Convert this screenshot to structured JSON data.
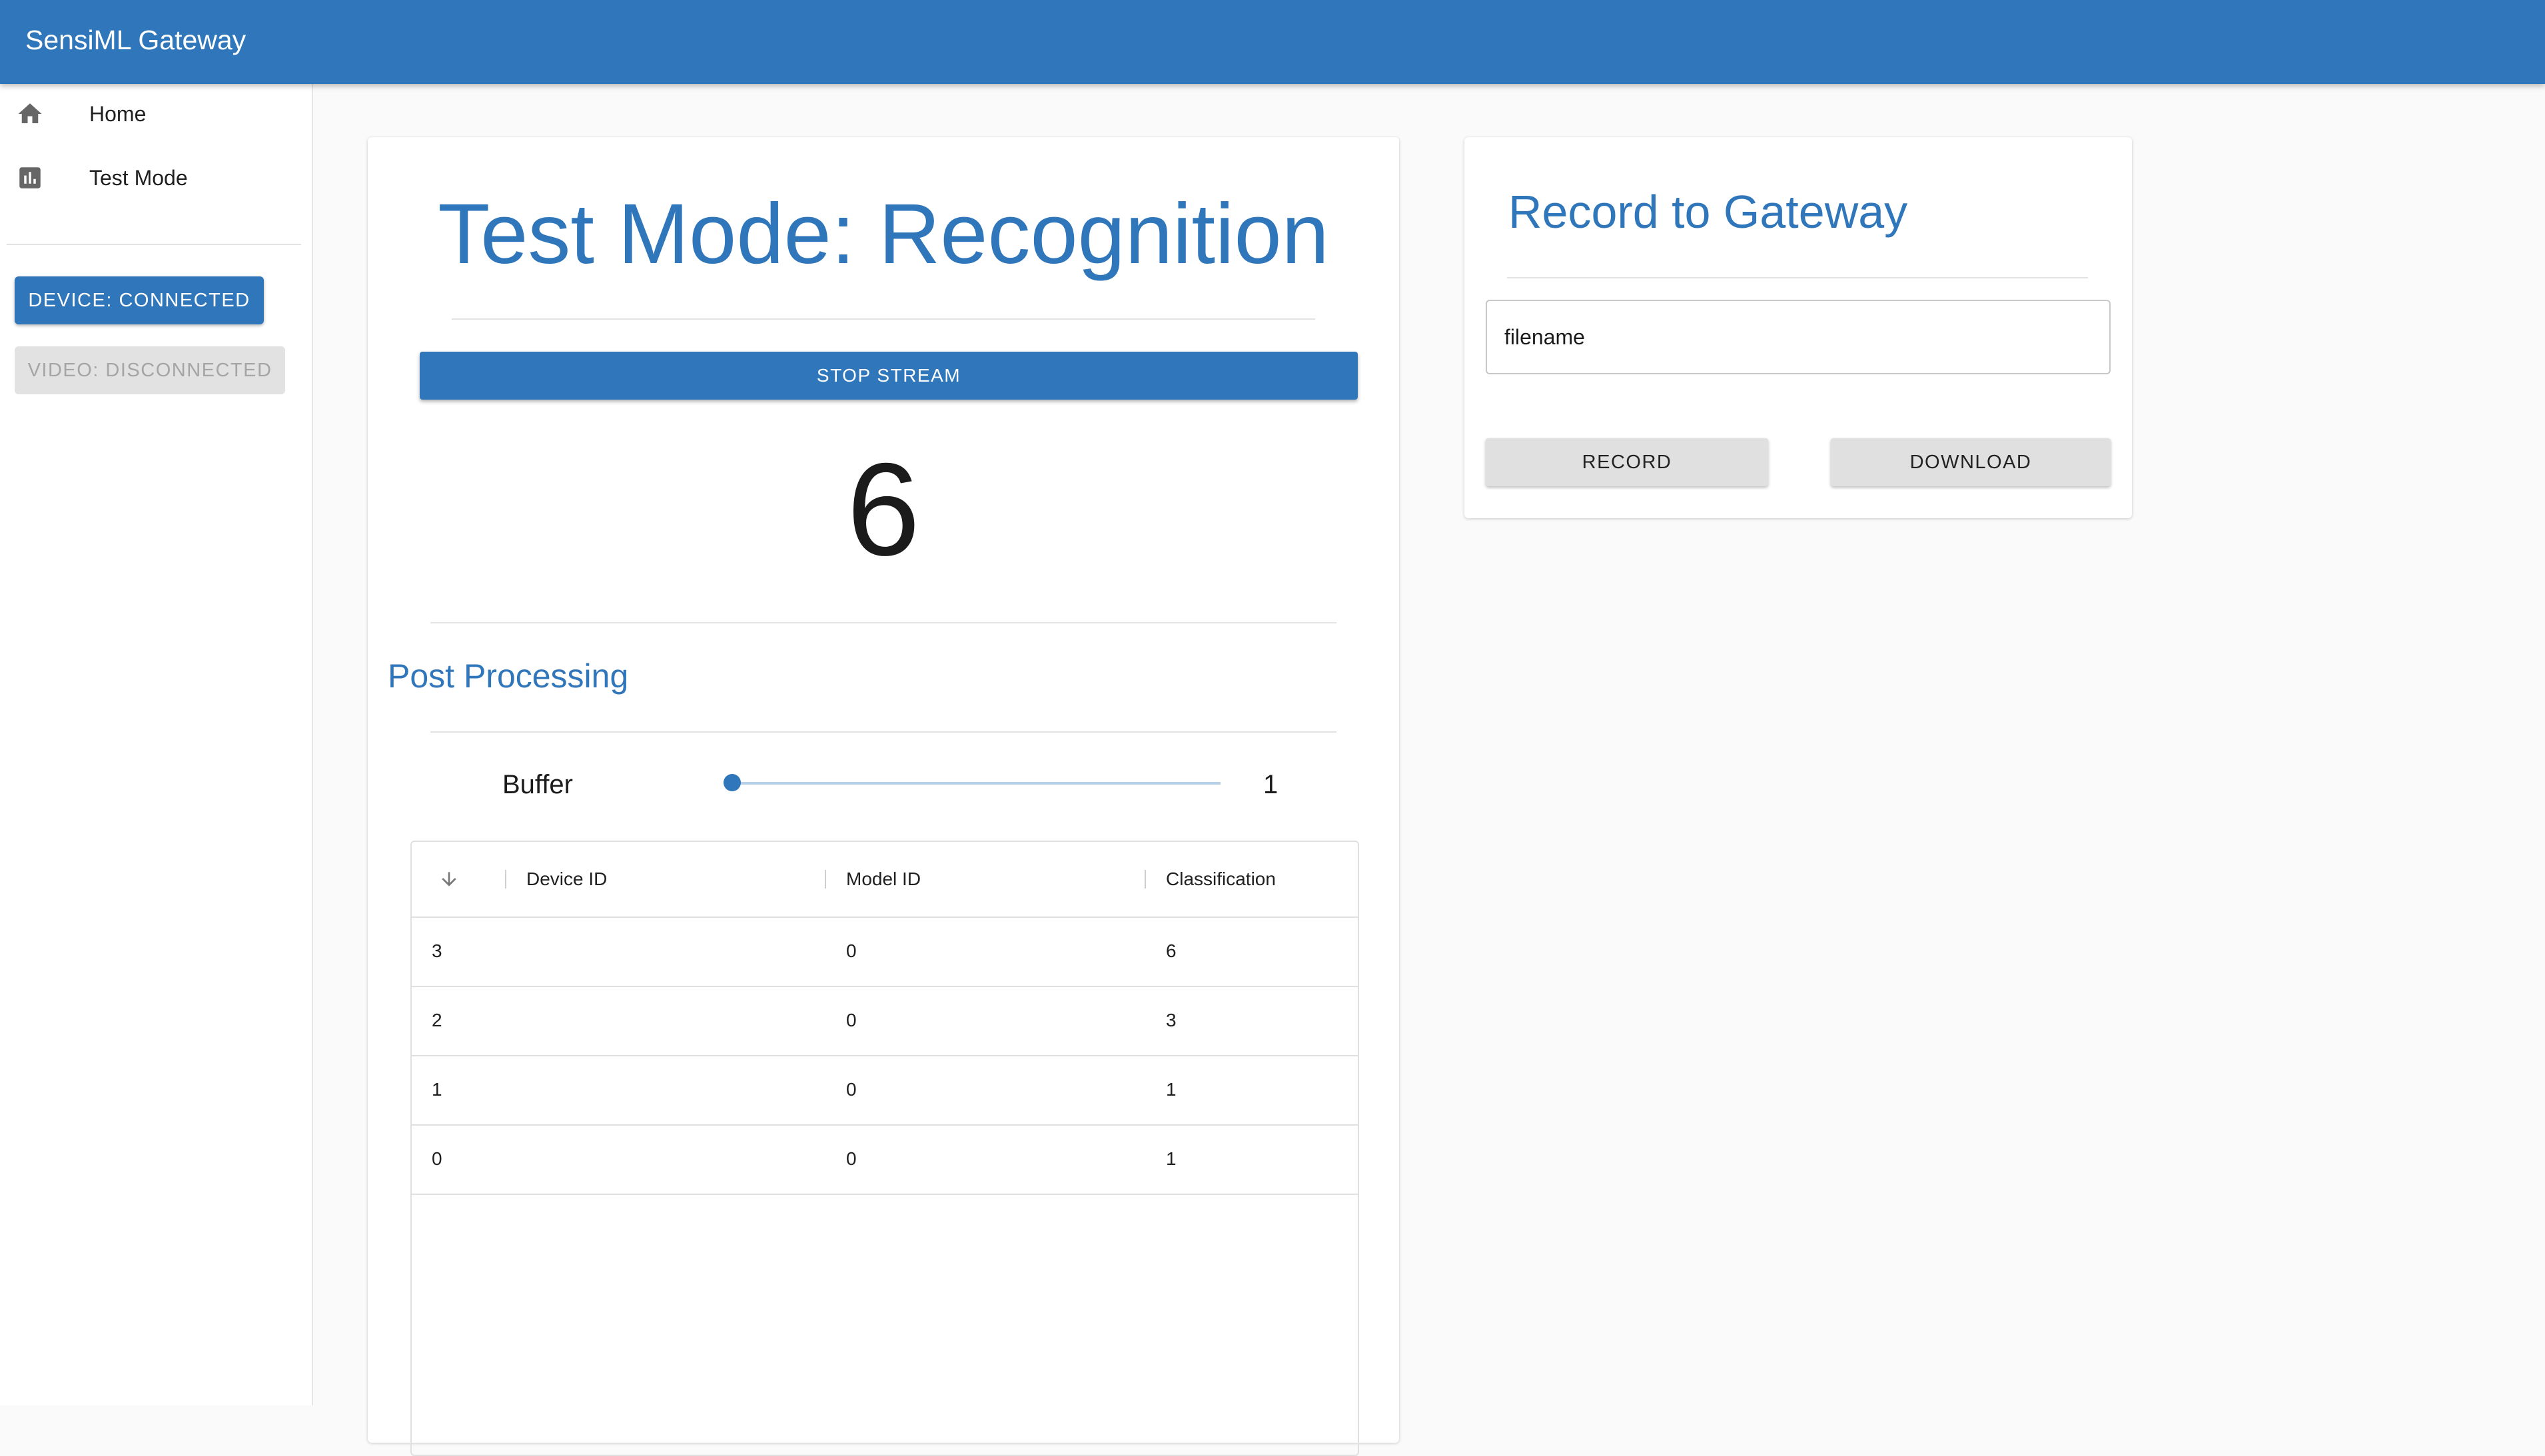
{
  "app": {
    "title": "SensiML Gateway"
  },
  "sidebar": {
    "items": [
      {
        "label": "Home",
        "icon": "home-icon"
      },
      {
        "label": "Test Mode",
        "icon": "bar-chart-icon"
      }
    ],
    "device_status": "DEVICE: CONNECTED",
    "video_status": "VIDEO: DISCONNECTED"
  },
  "main": {
    "title": "Test Mode: Recognition",
    "stream_button": "STOP STREAM",
    "current_classification": "6",
    "post_processing": {
      "title": "Post Processing",
      "buffer_label": "Buffer",
      "buffer_value": "1"
    },
    "table": {
      "sort_icon": "arrow-down-icon",
      "headers": [
        "Device ID",
        "Model ID",
        "Classification"
      ],
      "rows": [
        {
          "device_id": "3",
          "model_id": "0",
          "classification": "6"
        },
        {
          "device_id": "2",
          "model_id": "0",
          "classification": "3"
        },
        {
          "device_id": "1",
          "model_id": "0",
          "classification": "1"
        },
        {
          "device_id": "0",
          "model_id": "0",
          "classification": "1"
        }
      ]
    }
  },
  "record": {
    "title": "Record to Gateway",
    "filename_value": "filename",
    "record_button": "RECORD",
    "download_button": "DOWNLOAD"
  },
  "colors": {
    "primary": "#2f76bb",
    "background": "#fafafa",
    "disabled_bg": "#e2e2e2",
    "disabled_text": "#a5a5a5"
  }
}
